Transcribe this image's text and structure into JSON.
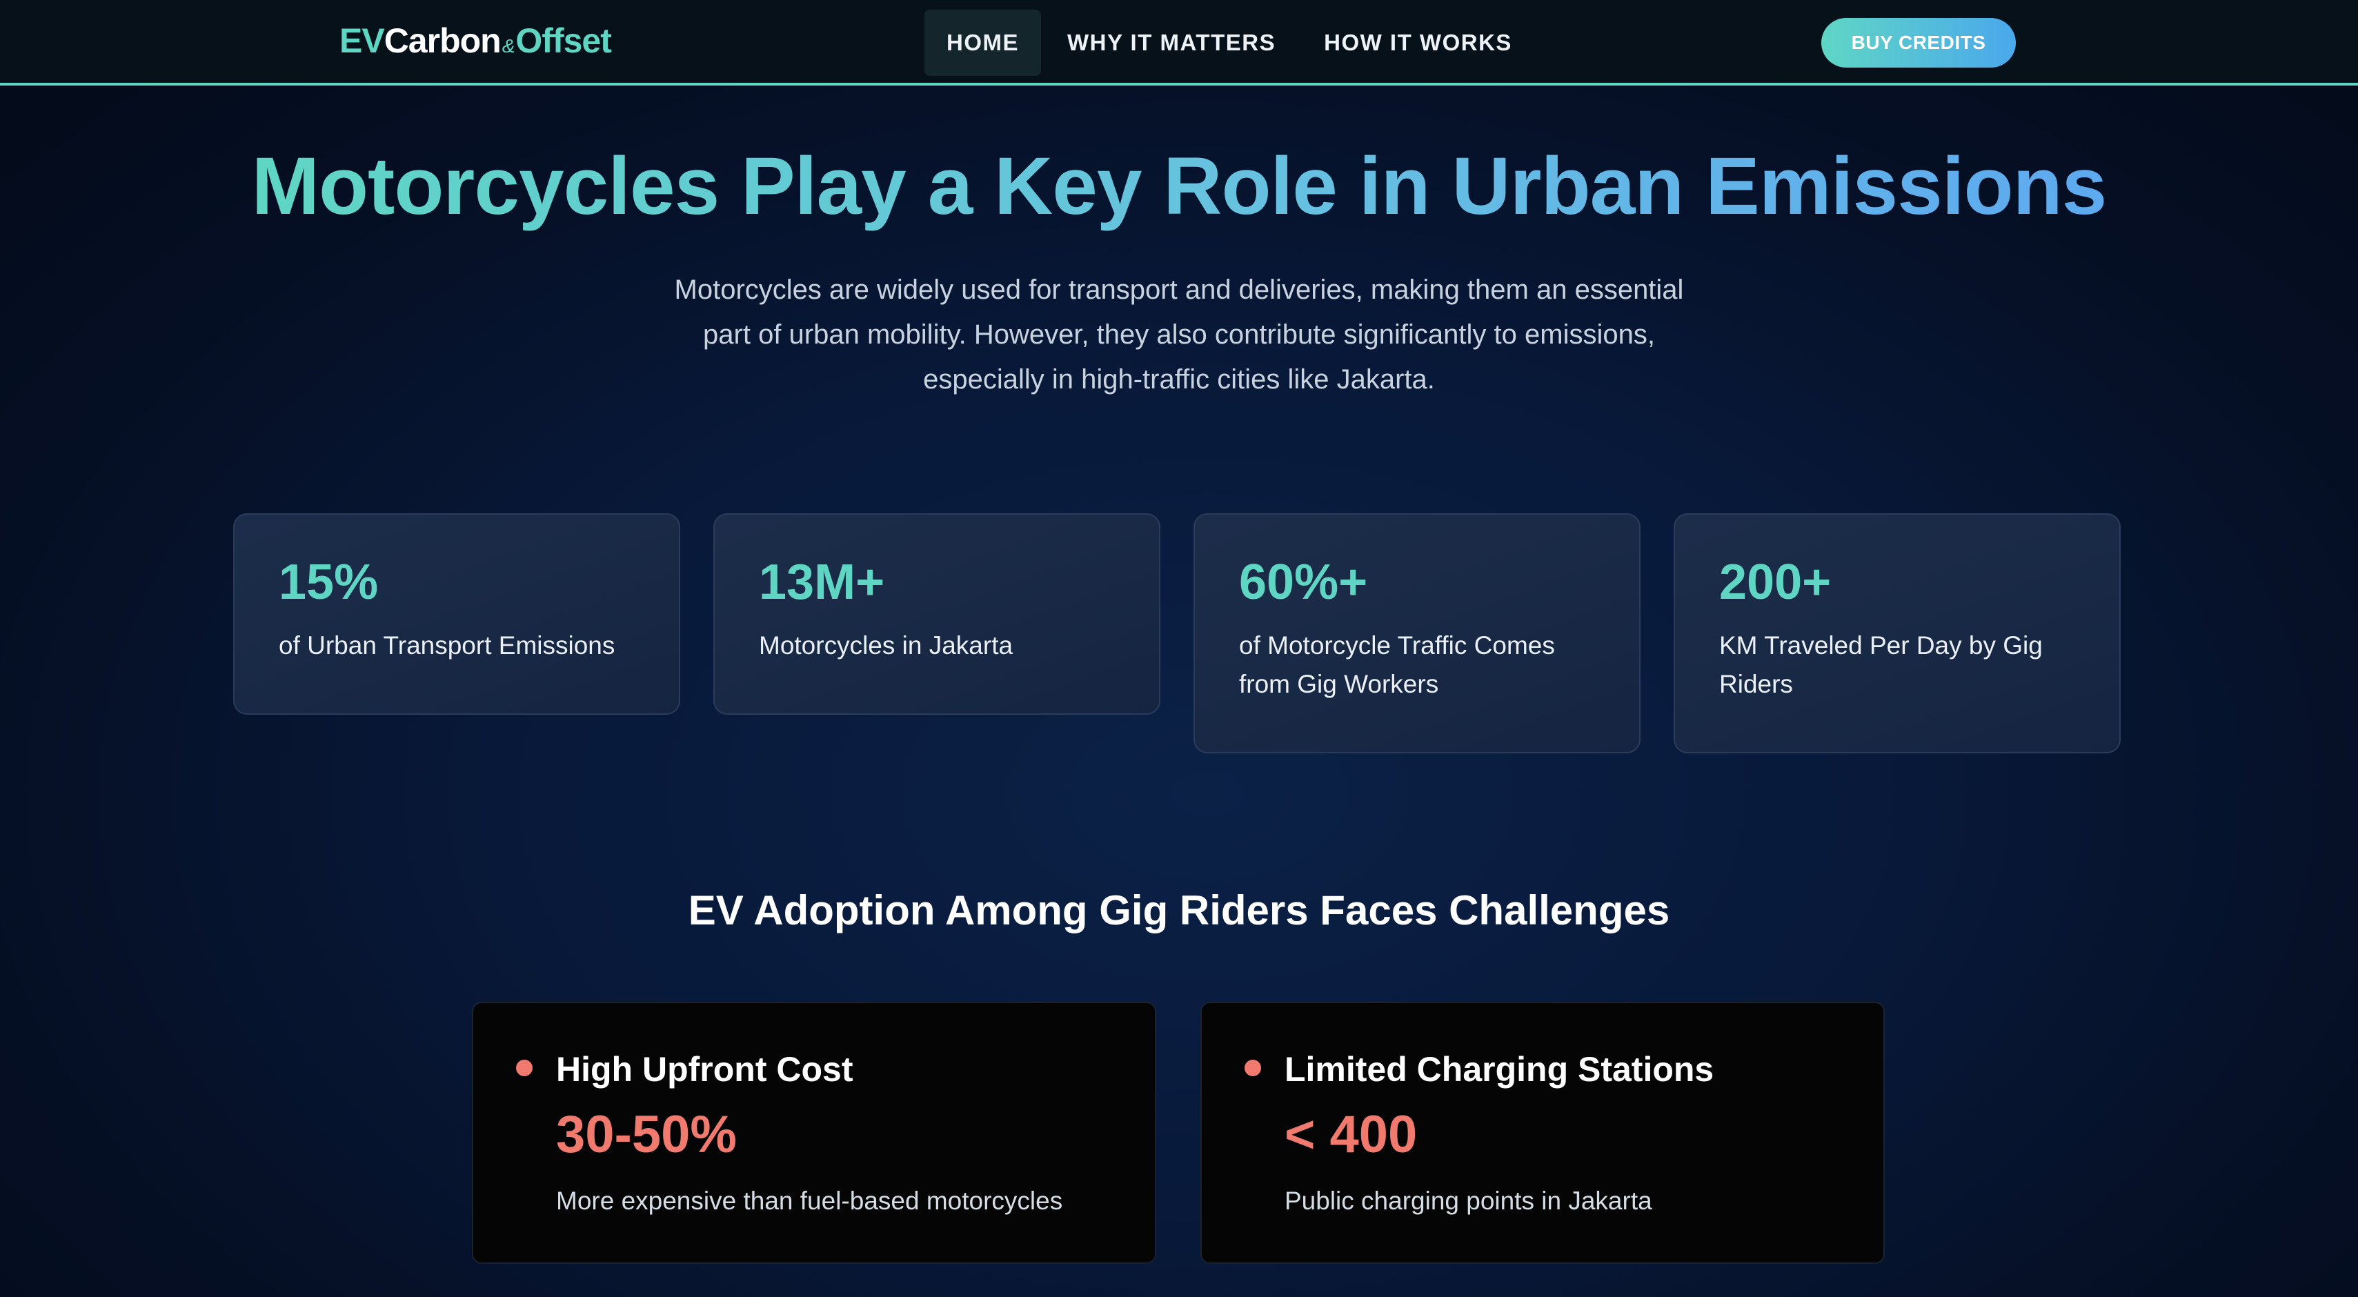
{
  "nav": {
    "logo": {
      "ev": "EV",
      "carbon": "Carbon",
      "amp": "&",
      "offset": "Offset"
    },
    "links": [
      "HOME",
      "WHY IT MATTERS",
      "HOW IT WORKS"
    ],
    "active": "HOME",
    "buy_label": "BUY CREDITS"
  },
  "hero": {
    "title": "Motorcycles Play a Key Role in Urban Emissions",
    "subtitle": "Motorcycles are widely used for transport and deliveries, making them an essential part of urban mobility. However, they also contribute significantly to emissions, especially in high-traffic cities like Jakarta."
  },
  "stats": [
    {
      "value": "15%",
      "label": "of Urban Transport Emissions"
    },
    {
      "value": "13M+",
      "label": "Motorcycles in Jakarta"
    },
    {
      "value": "60%+",
      "label": "of Motorcycle Traffic Comes from Gig Workers"
    },
    {
      "value": "200+",
      "label": "KM Traveled Per Day by Gig Riders"
    }
  ],
  "challenges": {
    "title": "EV Adoption Among Gig Riders Faces Challenges",
    "items": [
      {
        "title": "High Upfront Cost",
        "value": "30-50%",
        "desc": "More expensive than fuel-based motorcycles"
      },
      {
        "title": "Limited Charging Stations",
        "value": "< 400",
        "desc": "Public charging points in Jakarta"
      }
    ]
  },
  "colors": {
    "accent": "#5fd6c4",
    "accent_blue": "#4aa8ec",
    "alert": "#f07a6e",
    "background": "#08193a"
  }
}
